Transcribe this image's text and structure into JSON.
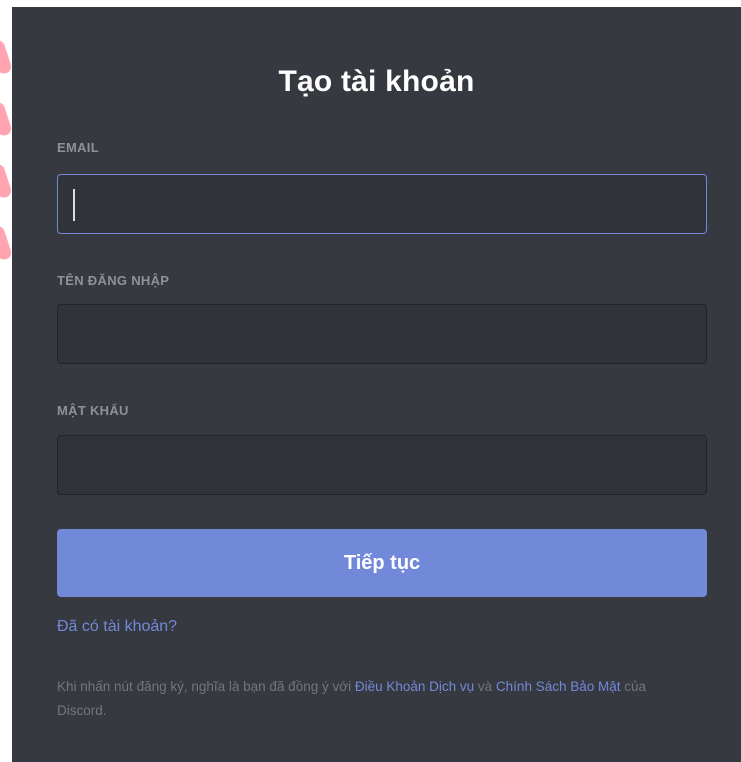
{
  "modal": {
    "title": "Tạo tài khoản"
  },
  "fields": {
    "email": {
      "label": "EMAIL",
      "value": ""
    },
    "username": {
      "label": "TÊN ĐĂNG NHẬP",
      "value": ""
    },
    "password": {
      "label": "MẬT KHẨU",
      "value": ""
    }
  },
  "actions": {
    "continue_label": "Tiếp tục",
    "login_link": "Đã có tài khoản?"
  },
  "terms": {
    "prefix": "Khi nhấn nút đăng ký, nghĩa là bạn đã đồng ý với ",
    "tos_link": "Điều Khoản Dịch vụ",
    "middle": " và ",
    "privacy_link": "Chính Sách Bảo Mật",
    "suffix": " của Discord."
  },
  "colors": {
    "background": "#36393f",
    "input_background": "#303339",
    "accent": "#7289da",
    "label": "#8e9297",
    "muted_text": "#72767d"
  }
}
